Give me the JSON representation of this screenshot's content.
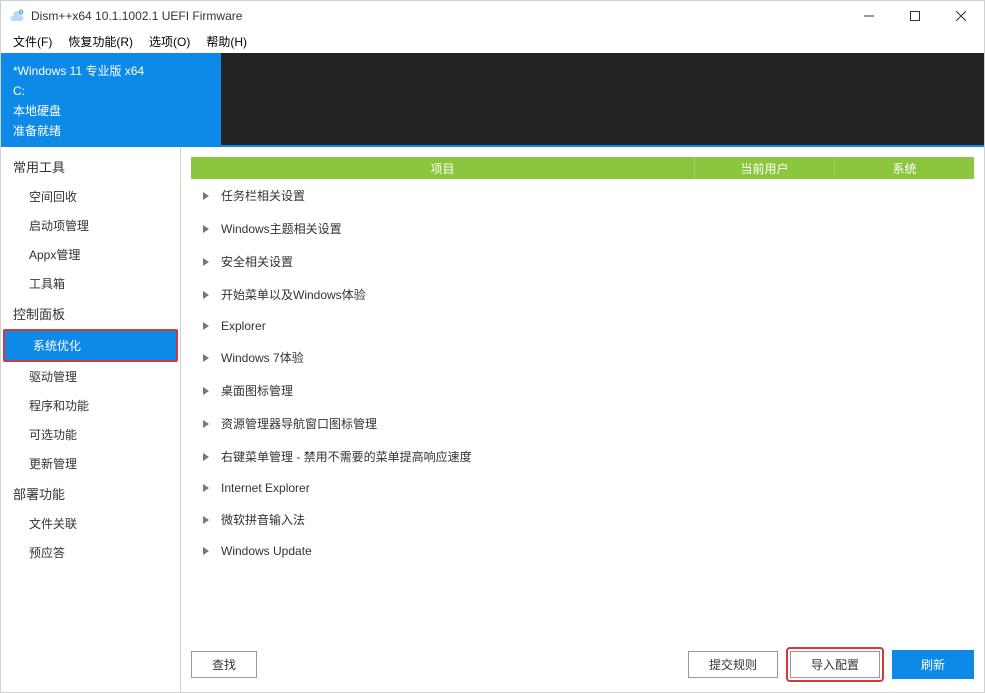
{
  "window": {
    "title": "Dism++x64 10.1.1002.1 UEFI Firmware"
  },
  "menubar": [
    "文件(F)",
    "恢复功能(R)",
    "选项(O)",
    "帮助(H)"
  ],
  "system_info": {
    "os": "*Windows 11 专业版 x64",
    "drive": "C:",
    "disk": "本地硬盘",
    "status": "准备就绪"
  },
  "sidebar": {
    "groups": [
      {
        "header": "常用工具",
        "items": [
          "空间回收",
          "启动项管理",
          "Appx管理",
          "工具箱"
        ]
      },
      {
        "header": "控制面板",
        "items": [
          "系统优化",
          "驱动管理",
          "程序和功能",
          "可选功能",
          "更新管理"
        ]
      },
      {
        "header": "部署功能",
        "items": [
          "文件关联",
          "预应答"
        ]
      }
    ],
    "active": "系统优化"
  },
  "tabs": {
    "c1": "项目",
    "c2": "当前用户",
    "c3": "系统"
  },
  "tree_items": [
    "任务栏相关设置",
    "Windows主题相关设置",
    "安全相关设置",
    "开始菜单以及Windows体验",
    "Explorer",
    "Windows 7体验",
    "桌面图标管理",
    "资源管理器导航窗口图标管理",
    "右键菜单管理 - 禁用不需要的菜单提高响应速度",
    "Internet Explorer",
    "微软拼音输入法",
    "Windows Update"
  ],
  "footer": {
    "find": "查找",
    "submit_rule": "提交规则",
    "import_config": "导入配置",
    "refresh": "刷新"
  }
}
